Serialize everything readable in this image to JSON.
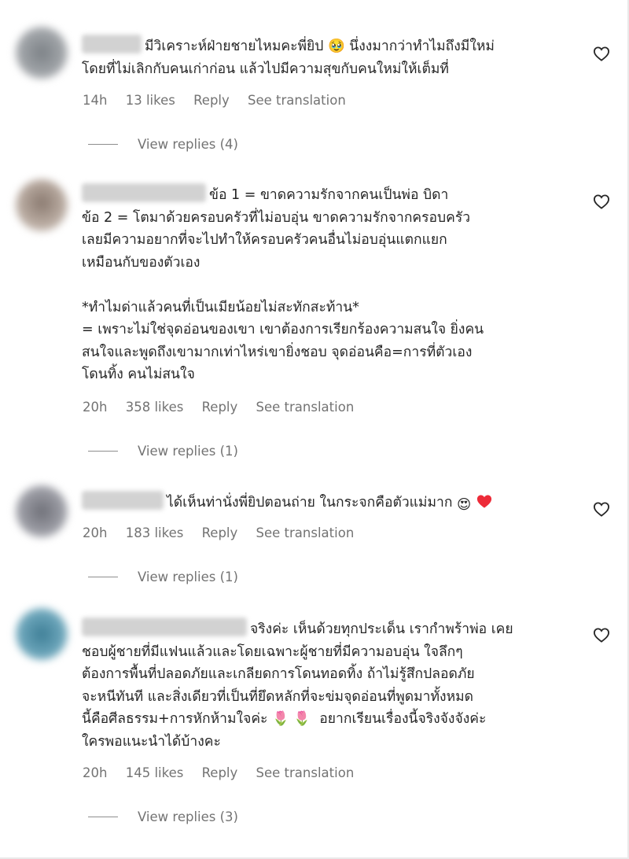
{
  "colors": {
    "text": "#262626",
    "secondary": "#737373",
    "heart_red": "#ed2b38",
    "heart_outline": "#262626"
  },
  "comments": [
    {
      "text": "มีวิเคราะห์ฝ่ายชายไหมคะพี่ยิป 🥹 นึ่งงมากว่าทำไมถึงมีใหม่\nโดยที่ไม่เลิกกับคนเก่าก่อน แล้วไปมีความสุขกับคนใหม่ให้เต็มที่",
      "time": "14h",
      "likes": "13 likes",
      "reply": "Reply",
      "see_translation": "See translation",
      "view_replies": "View replies (4)"
    },
    {
      "text": "ข้อ 1 = ขาดความรักจากคนเป็นพ่อ บิดา\nข้อ 2 = โตมาด้วยครอบครัวที่ไม่อบอุ่น ขาดความรักจากครอบครัว\nเลยมีความอยากที่จะไปทำให้ครอบครัวคนอื่นไม่อบอุ่นแตกแยก\nเหมือนกับของตัวเอง\n\n*ทำไมด่าแล้วคนที่เป็นเมียน้อยไม่สะทักสะท้าน*\n= เพราะไม่ใช่จุดอ่อนของเขา เขาต้องการเรียกร้องความสนใจ ยิ่งคน\nสนใจและพูดถึงเขามากเท่าไหร่เขายิ่งชอบ จุดอ่อนคือ=การที่ตัวเอง\nโดนทิ้ง คนไม่สนใจ",
      "time": "20h",
      "likes": "358 likes",
      "reply": "Reply",
      "see_translation": "See translation",
      "view_replies": "View replies (1)"
    },
    {
      "text": "ได้เห็นท่านั่งพี่ยิปตอนถ่าย ในกระจกคือตัวแม่มาก",
      "emojis": "😍",
      "time": "20h",
      "likes": "183 likes",
      "reply": "Reply",
      "see_translation": "See translation",
      "view_replies": "View replies (1)"
    },
    {
      "text": "จริงค่ะ เห็นด้วยทุกประเด็น เรากำพร้าพ่อ เคย\nชอบผู้ชายที่มีแฟนแล้วและโดยเฉพาะผู้ชายที่มีความอบอุ่น ใจลึกๆ\nต้องการพื้นที่ปลอดภัยและเกลียดการโดนทอดทิ้ง ถ้าไม่รู้สึกปลอดภัย\nจะหนีทันที และสิ่งเดียวที่เป็นที่ยึดหลักที่จะข่มจุดอ่อนที่พูดมาทั้งหมด\nนี้คือศีลธรรม+การหักห้ามใจค่ะ 🌷 🌷  อยากเรียนเรื่องนี้จริงจังจังค่ะ\nใครพอแนะนำได้บ้างคะ",
      "time": "20h",
      "likes": "145 likes",
      "reply": "Reply",
      "see_translation": "See translation",
      "view_replies": "View replies (3)"
    }
  ]
}
